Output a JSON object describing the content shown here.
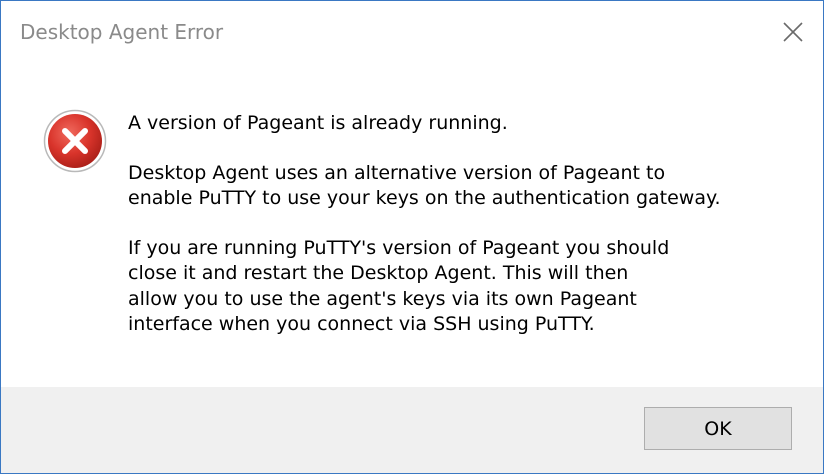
{
  "window": {
    "title": "Desktop Agent Error",
    "close_icon": "close-icon"
  },
  "message": {
    "icon": "error-icon",
    "paragraphs": [
      {
        "lines": [
          "A version of Pageant is already running."
        ]
      },
      {
        "lines": [
          "Desktop Agent uses an alternative version of Pageant to",
          "enable PuTTY to use your keys on the authentication gateway."
        ]
      },
      {
        "lines": [
          "If you are running PuTTY's version of Pageant you should",
          "close it and restart the Desktop Agent. This will then",
          "allow you to use the agent's keys via its own Pageant",
          "interface when you connect via SSH using PuTTY."
        ]
      }
    ]
  },
  "buttons": {
    "ok_label": "OK"
  },
  "colors": {
    "border": "#3a78c3",
    "error_red": "#d9342b",
    "footer_bg": "#f0f0f0"
  }
}
